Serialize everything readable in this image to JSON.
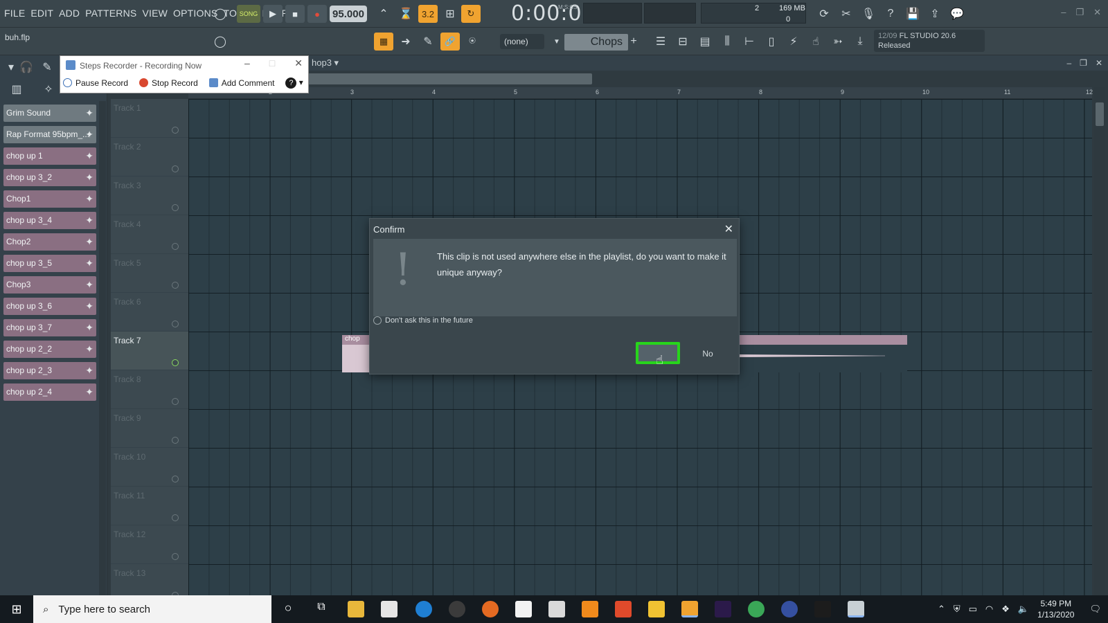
{
  "menu": [
    "FILE",
    "EDIT",
    "ADD",
    "PATTERNS",
    "VIEW",
    "OPTIONS",
    "TOOLS",
    "HELP"
  ],
  "transport": {
    "song_label": "SONG",
    "tempo": "95.000",
    "time": "0:00:00",
    "time_format": "M:S:CS",
    "step_label": "3.2"
  },
  "resources": {
    "cpu_value": "2",
    "ram": "169 MB",
    "poly": "0"
  },
  "file": {
    "name": "buh.flp"
  },
  "channel": {
    "pattern_select": "(none)",
    "pattern_name": "Chops",
    "add_label": "+"
  },
  "news": {
    "date": "12/09",
    "title": "FL STUDIO 20.6",
    "status": "Released"
  },
  "browser_clips": [
    {
      "label": "Grim Sound",
      "kind": "audio"
    },
    {
      "label": "Rap Format 95bpm_...",
      "kind": "audio"
    },
    {
      "label": "chop up 1",
      "kind": "chop"
    },
    {
      "label": "chop up 3_2",
      "kind": "chop"
    },
    {
      "label": "Chop1",
      "kind": "chop"
    },
    {
      "label": "chop up 3_4",
      "kind": "chop"
    },
    {
      "label": "Chop2",
      "kind": "chop"
    },
    {
      "label": "chop up 3_5",
      "kind": "chop"
    },
    {
      "label": "Chop3",
      "kind": "chop"
    },
    {
      "label": "chop up 3_6",
      "kind": "chop"
    },
    {
      "label": "chop up 3_7",
      "kind": "chop"
    },
    {
      "label": "chop up 2_2",
      "kind": "chop"
    },
    {
      "label": "chop up 2_3",
      "kind": "chop"
    },
    {
      "label": "chop up 2_4",
      "kind": "chop"
    }
  ],
  "playlist": {
    "title": "hop3",
    "ruler": [
      "2",
      "3",
      "4",
      "5",
      "6",
      "7",
      "8",
      "9",
      "10",
      "11",
      "12"
    ],
    "tracks": [
      "Track 1",
      "Track 2",
      "Track 3",
      "Track 4",
      "Track 5",
      "Track 6",
      "Track 7",
      "Track 8",
      "Track 9",
      "Track 10",
      "Track 11",
      "Track 12",
      "Track 13"
    ],
    "active_track": "Track 7",
    "clip_label": "chop"
  },
  "steps_recorder": {
    "title": "Steps Recorder - Recording Now",
    "pause": "Pause Record",
    "stop": "Stop Record",
    "comment": "Add Comment",
    "help": "?"
  },
  "dialog": {
    "title": "Confirm",
    "message": "This clip is not used anywhere else in the playlist, do you want to make it unique anyway?",
    "checkbox": "Don't ask this in the future",
    "no": "No"
  },
  "taskbar": {
    "search_placeholder": "Type here to search",
    "time": "5:49 PM",
    "date": "1/13/2020"
  },
  "colors": {
    "accent_orange": "#f0a330",
    "highlight_green": "#27d51b",
    "clip_pink": "#8a6f82"
  }
}
